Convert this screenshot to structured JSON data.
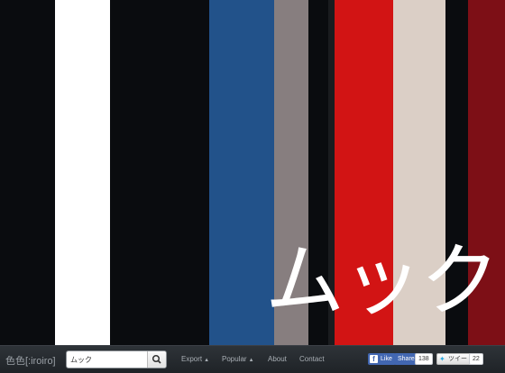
{
  "main": {
    "color_name": "ムック",
    "palette": [
      "#0a0c0f",
      "#ffffff",
      "#0a0c0f",
      "#22528a",
      "#877e7f",
      "#0a0c0f",
      "#1a1c1f",
      "#d21414",
      "#dbcfc6",
      "#0a0c0f",
      "#7d0f16"
    ]
  },
  "bottom_bar": {
    "logo": "色色[:iroiro]",
    "search": {
      "value": "ムック",
      "placeholder": "",
      "button_icon": "search-icon"
    },
    "nav": [
      {
        "label": "Export",
        "has_caret": true
      },
      {
        "label": "Popular",
        "has_caret": true
      },
      {
        "label": "About",
        "has_caret": false
      },
      {
        "label": "Contact",
        "has_caret": false
      }
    ],
    "social": {
      "facebook_like_label": "Like",
      "facebook_share_label": "Share",
      "facebook_count": "138",
      "tweet_label": "ツイート",
      "tweet_count": "22"
    }
  }
}
